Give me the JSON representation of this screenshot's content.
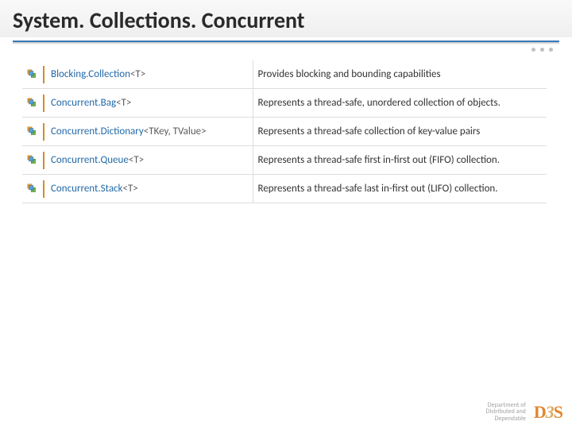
{
  "title": "System. Collections. Concurrent",
  "rows": [
    {
      "class": "Blocking.Collection",
      "tparam": "<T>",
      "desc": "Provides blocking and bounding capabilities"
    },
    {
      "class": "Concurrent.Bag",
      "tparam": "<T>",
      "desc": "Represents a thread-safe, unordered collection of objects."
    },
    {
      "class": "Concurrent.Dictionary",
      "tparam": "<TKey, TValue>",
      "desc": "Represents a thread-safe collection of key-value pairs"
    },
    {
      "class": "Concurrent.Queue",
      "tparam": "<T>",
      "desc": "Represents a thread-safe first in-first out (FIFO) collection."
    },
    {
      "class": "Concurrent.Stack",
      "tparam": "<T>",
      "desc": "Represents a thread-safe last in-first out (LIFO) collection."
    }
  ],
  "footer": {
    "line1": "Department of",
    "line2": "Distributed and",
    "line3": "Dependable",
    "logo_d": "D",
    "logo_3": "3",
    "logo_s": "S"
  }
}
